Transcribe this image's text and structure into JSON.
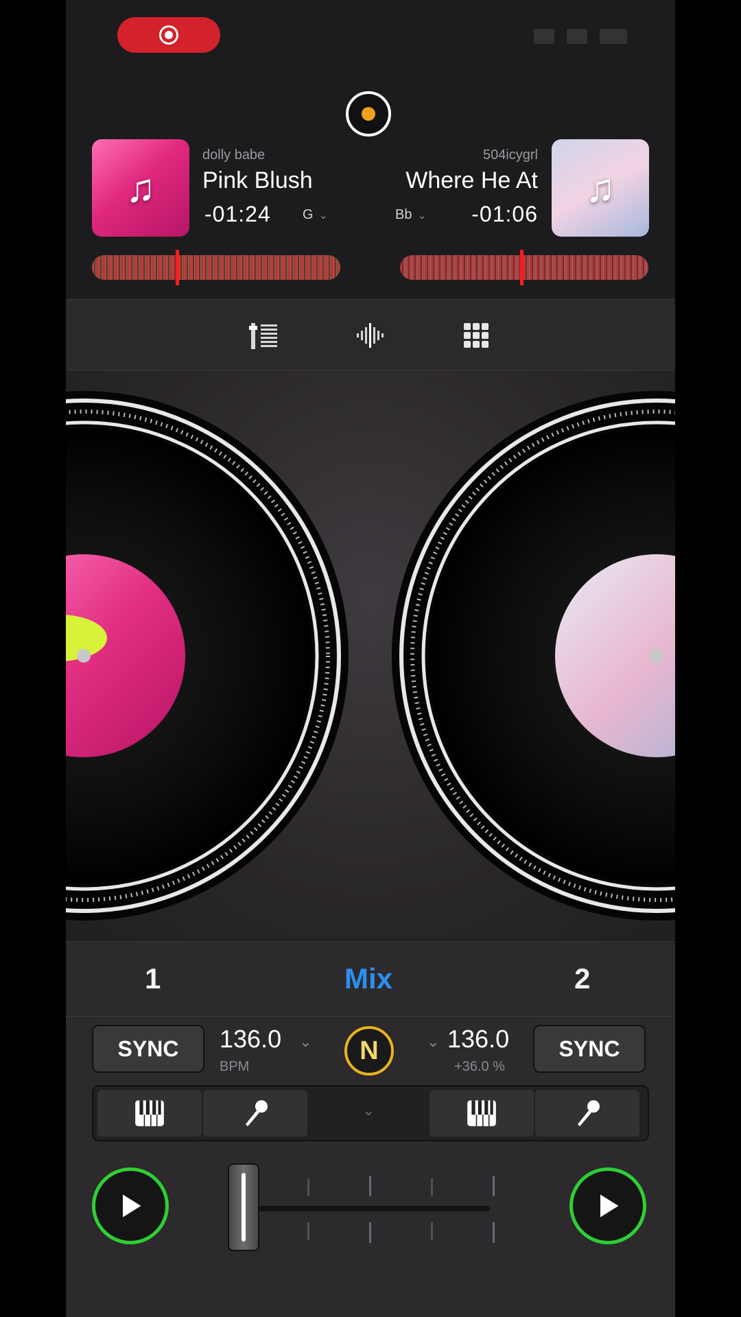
{
  "status_bar": {
    "record_icon": "screen-record-icon"
  },
  "deck1": {
    "artist": "dolly babe",
    "title": "Pink Blush",
    "time_remaining": "-01:24",
    "key": "G",
    "bpm": "136.0",
    "bpm_label": "BPM",
    "sync_label": "SYNC",
    "tab_label": "1"
  },
  "deck2": {
    "artist": "504icygrl",
    "title": "Where He At",
    "time_remaining": "-01:06",
    "key": "Bb",
    "bpm": "136.0",
    "pitch": "+36.0 %",
    "sync_label": "SYNC",
    "tab_label": "2"
  },
  "mix_tab_label": "Mix",
  "center_button": "N",
  "crossfader_position": 0.0,
  "colors": {
    "accent_blue": "#2d8ef0",
    "play_green": "#2ecf35",
    "record_red": "#d3222b",
    "playhead_red": "#ff1c1c",
    "n_button_gold": "#e8b31f"
  }
}
